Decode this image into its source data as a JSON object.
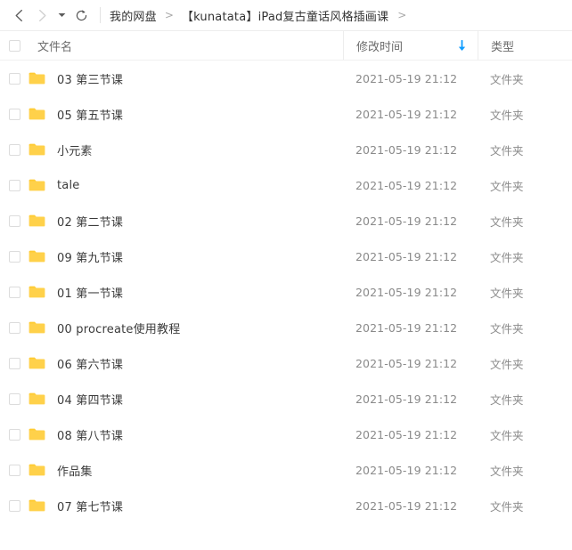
{
  "toolbar": {
    "back": {
      "name": "back",
      "title": "后退",
      "enabled": true
    },
    "forward": {
      "name": "forward",
      "title": "前进",
      "enabled": false
    },
    "history_dropdown": {
      "name": "history-dropdown",
      "title": "历史记录"
    },
    "refresh": {
      "name": "refresh",
      "title": "刷新"
    }
  },
  "breadcrumb": {
    "separator": ">",
    "items": [
      {
        "label": "我的网盘"
      },
      {
        "label": "【kunatata】iPad复古童话风格插画课"
      }
    ],
    "trailing_separator": ">"
  },
  "columns": {
    "name": "文件名",
    "modified": "修改时间",
    "type": "类型",
    "sort": {
      "column": "修改时间",
      "direction": "desc",
      "glyph": "arrow-down",
      "color": "#0f9cff"
    }
  },
  "colors": {
    "accent": "#06a7ff",
    "sort_arrow": "#0f9cff",
    "folder": "#ffd14a",
    "folder_tab": "#ffcb33",
    "text_primary": "#3b3b3b",
    "text_muted": "#8a8a8a",
    "border": "#ededed"
  },
  "files": [
    {
      "name": "03 第三节课",
      "modified": "2021-05-19 21:12",
      "type": "文件夹",
      "icon": "folder-icon"
    },
    {
      "name": "05 第五节课",
      "modified": "2021-05-19 21:12",
      "type": "文件夹",
      "icon": "folder-icon"
    },
    {
      "name": "小元素",
      "modified": "2021-05-19 21:12",
      "type": "文件夹",
      "icon": "folder-icon"
    },
    {
      "name": "tale",
      "modified": "2021-05-19 21:12",
      "type": "文件夹",
      "icon": "folder-icon"
    },
    {
      "name": "02 第二节课",
      "modified": "2021-05-19 21:12",
      "type": "文件夹",
      "icon": "folder-icon"
    },
    {
      "name": "09 第九节课",
      "modified": "2021-05-19 21:12",
      "type": "文件夹",
      "icon": "folder-icon"
    },
    {
      "name": "01 第一节课",
      "modified": "2021-05-19 21:12",
      "type": "文件夹",
      "icon": "folder-icon"
    },
    {
      "name": "00 procreate使用教程",
      "modified": "2021-05-19 21:12",
      "type": "文件夹",
      "icon": "folder-icon"
    },
    {
      "name": "06 第六节课",
      "modified": "2021-05-19 21:12",
      "type": "文件夹",
      "icon": "folder-icon"
    },
    {
      "name": "04 第四节课",
      "modified": "2021-05-19 21:12",
      "type": "文件夹",
      "icon": "folder-icon"
    },
    {
      "name": "08 第八节课",
      "modified": "2021-05-19 21:12",
      "type": "文件夹",
      "icon": "folder-icon"
    },
    {
      "name": "作品集",
      "modified": "2021-05-19 21:12",
      "type": "文件夹",
      "icon": "folder-icon"
    },
    {
      "name": "07 第七节课",
      "modified": "2021-05-19 21:12",
      "type": "文件夹",
      "icon": "folder-icon"
    }
  ]
}
